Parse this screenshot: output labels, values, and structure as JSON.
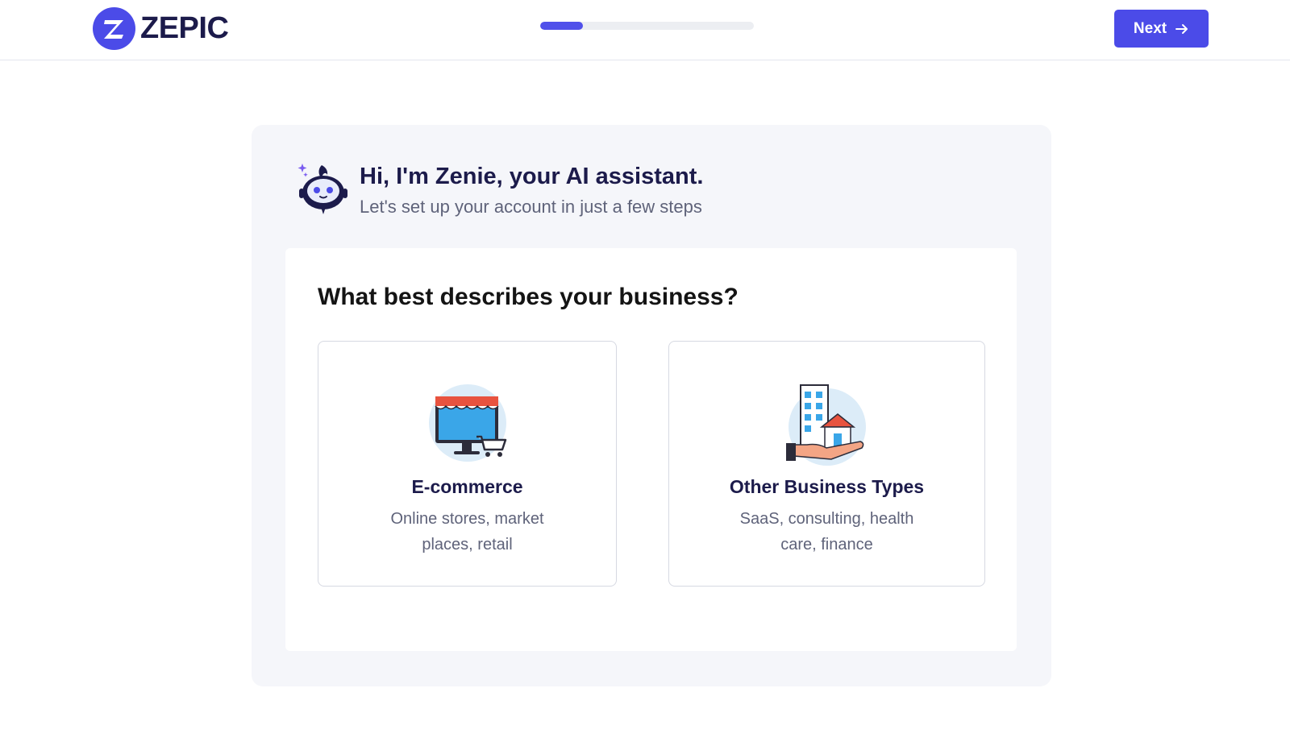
{
  "header": {
    "brand_name": "ZEPIC",
    "progress_fraction": 0.2,
    "next_label": "Next",
    "accent_color": "#4b4be8"
  },
  "assistant": {
    "title": "Hi, I'm Zenie, your AI assistant.",
    "subtitle": "Let's set up your account in just a few steps"
  },
  "question": {
    "text": "What best describes your business?",
    "options": [
      {
        "title": "E-commerce",
        "description": "Online stores, market places, retail",
        "icon": "storefront-cart-icon"
      },
      {
        "title": "Other Business Types",
        "description": "SaaS, consulting, health care, finance",
        "icon": "buildings-hand-icon"
      }
    ]
  }
}
